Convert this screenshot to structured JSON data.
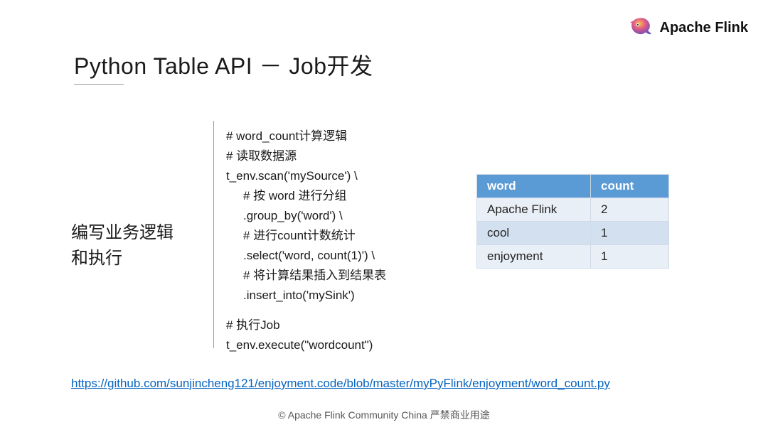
{
  "brand": {
    "name": "Apache Flink"
  },
  "title": "Python Table API － Job开发",
  "subtitle_line1": "编写业务逻辑",
  "subtitle_line2": "和执行",
  "code": {
    "l1": "#  word_count计算逻辑",
    "l2": "# 读取数据源",
    "l3": "t_env.scan('mySource') \\",
    "l4": "# 按 word 进行分组",
    "l5": ".group_by('word') \\",
    "l6": "# 进行count计数统计",
    "l7": ".select('word, count(1)') \\",
    "l8": "# 将计算结果插入到结果表",
    "l9": ".insert_into('mySink')",
    "l10": "# 执行Job",
    "l11": "t_env.execute(\"wordcount\")"
  },
  "table": {
    "headers": {
      "word": "word",
      "count": "count"
    },
    "rows": [
      {
        "word": "Apache Flink",
        "count": "2"
      },
      {
        "word": "cool",
        "count": "1"
      },
      {
        "word": "enjoyment",
        "count": "1"
      }
    ]
  },
  "link": {
    "text": "https://github.com/sunjincheng121/enjoyment.code/blob/master/myPyFlink/enjoyment/word_count.py",
    "href": "https://github.com/sunjincheng121/enjoyment.code/blob/master/myPyFlink/enjoyment/word_count.py"
  },
  "footer": "© Apache Flink Community China  严禁商业用途"
}
